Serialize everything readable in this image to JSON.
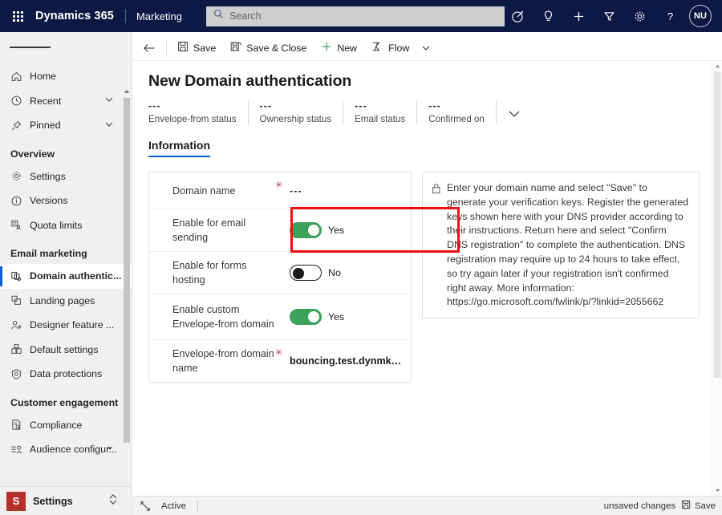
{
  "topnav": {
    "waffle_label": "app-launcher",
    "brand": "Dynamics 365",
    "app_name": "Marketing",
    "search_placeholder": "Search",
    "search_value": "",
    "icons": [
      "target-icon",
      "lightbulb-icon",
      "plus-icon",
      "filter-icon",
      "gear-icon",
      "help-icon"
    ],
    "avatar_initials": "NU"
  },
  "sidebar": {
    "items": [
      {
        "label": "Home",
        "icon": "home-icon",
        "chevron": false,
        "selected": false
      },
      {
        "label": "Recent",
        "icon": "clock-icon",
        "chevron": true,
        "selected": false
      },
      {
        "label": "Pinned",
        "icon": "pin-icon",
        "chevron": true,
        "selected": false
      }
    ],
    "group_overview": "Overview",
    "overview_items": [
      {
        "label": "Settings",
        "icon": "gear-icon",
        "selected": false
      },
      {
        "label": "Versions",
        "icon": "info-circle-icon",
        "selected": false
      },
      {
        "label": "Quota limits",
        "icon": "quota-icon",
        "selected": false
      }
    ],
    "group_email": "Email marketing",
    "email_items": [
      {
        "label": "Domain authentic...",
        "icon": "domain-auth-icon",
        "selected": true
      },
      {
        "label": "Landing pages",
        "icon": "pages-icon",
        "selected": false
      },
      {
        "label": "Designer feature ...",
        "icon": "designer-icon",
        "selected": false
      },
      {
        "label": "Default settings",
        "icon": "default-settings-icon",
        "selected": false
      },
      {
        "label": "Data protections",
        "icon": "shield-icon",
        "selected": false
      }
    ],
    "group_customer": "Customer engagement",
    "customer_items": [
      {
        "label": "Compliance",
        "icon": "compliance-icon",
        "selected": false
      },
      {
        "label": "Audience configur...",
        "icon": "audience-icon",
        "selected": false
      }
    ],
    "app_switcher": {
      "badge": "S",
      "name": "Settings"
    }
  },
  "commandbar": {
    "back": "back-arrow",
    "save_label": "Save",
    "save_close_label": "Save & Close",
    "new_label": "New",
    "flow_label": "Flow"
  },
  "page": {
    "title": "New Domain authentication",
    "status_items": [
      {
        "value": "---",
        "caption": "Envelope-from status"
      },
      {
        "value": "---",
        "caption": "Ownership status"
      },
      {
        "value": "---",
        "caption": "Email status"
      },
      {
        "value": "---",
        "caption": "Confirmed on"
      }
    ],
    "tabs": [
      {
        "label": "Information",
        "active": true
      }
    ]
  },
  "form": {
    "rows": [
      {
        "label": "Domain name",
        "required": true,
        "type": "text",
        "value": "---",
        "highlight": false
      },
      {
        "label": "Enable for email sending",
        "required": false,
        "type": "toggle",
        "state": "on",
        "value": "Yes",
        "highlight": false
      },
      {
        "label": "Enable for forms hosting",
        "required": false,
        "type": "toggle",
        "state": "off",
        "value": "No",
        "highlight": false
      },
      {
        "label": "Enable custom Envelope-from domain",
        "required": false,
        "type": "toggle",
        "state": "on",
        "value": "Yes",
        "highlight": true
      },
      {
        "label": "Envelope-from domain name",
        "required": true,
        "type": "text",
        "value": "bouncing.test.dynmkt.do...",
        "highlight": false
      }
    ]
  },
  "info_panel": {
    "icon": "lock-icon",
    "text": "Enter your domain name and select \"Save\" to generate your verification keys. Register the generated keys shown here with your DNS provider according to their instructions. Return here and select \"Confirm DNS registration\" to complete the authentication. DNS registration may require up to 24 hours to take effect, so try again later if your registration isn't confirmed right away. More information: https://go.microsoft.com/fwlink/p/?linkid=2055662"
  },
  "statusbar": {
    "expand_icon": "expand-icon",
    "state": "Active",
    "unsaved": "unsaved changes",
    "save_label": "Save"
  },
  "colors": {
    "nav_bg": "#0d1844",
    "accent": "#0b5cd5",
    "toggle_on": "#3aa25a",
    "required": "#d13438",
    "highlight": "#ee1111",
    "app_badge": "#b7312c"
  }
}
